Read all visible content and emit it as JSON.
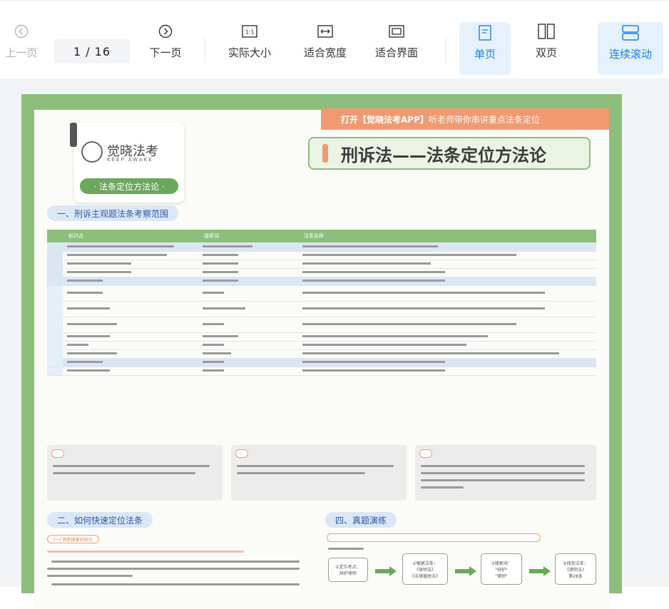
{
  "toolbar": {
    "prev_label": "上一页",
    "page_indicator": "1  /  16",
    "next_label": "下一页",
    "actual_size_label": "实际大小",
    "actual_size_icon_text": "1:1",
    "fit_width_label": "适合宽度",
    "fit_page_label": "适合界面",
    "single_page_label": "单页",
    "double_page_label": "双页",
    "continuous_label": "连续滚动",
    "colors": {
      "active_bg": "#e5f1fd",
      "active_text": "#1a7ff0"
    }
  },
  "document": {
    "logo_name": "觉晓法考",
    "logo_sub": "KEEP AWAKE",
    "logo_tag": "· 法条定位方法论 ·",
    "banner_bold": "打开【觉晓法考APP】",
    "banner_light": "听老师带你串讲重点法条定位",
    "title": "刑诉法——法条定位方法论",
    "section1": "一、刑诉主观题法条考察范围",
    "table_headers": [
      "知识点",
      "搜索词",
      "法条名称"
    ],
    "section2": "二、如何快速定位法条",
    "section2_sub": "(一) 熟悉搜索的技巧",
    "section4": "四、真题演练",
    "flow_boxes": [
      "①定位考点：\n辩护律师",
      "②根据法条：\n《律师法》\n《法律援助法》",
      "③搜索词：\n\"辩护\"\n\"律师\"",
      "④找到法条：\n《律师法》\n第28条"
    ]
  }
}
